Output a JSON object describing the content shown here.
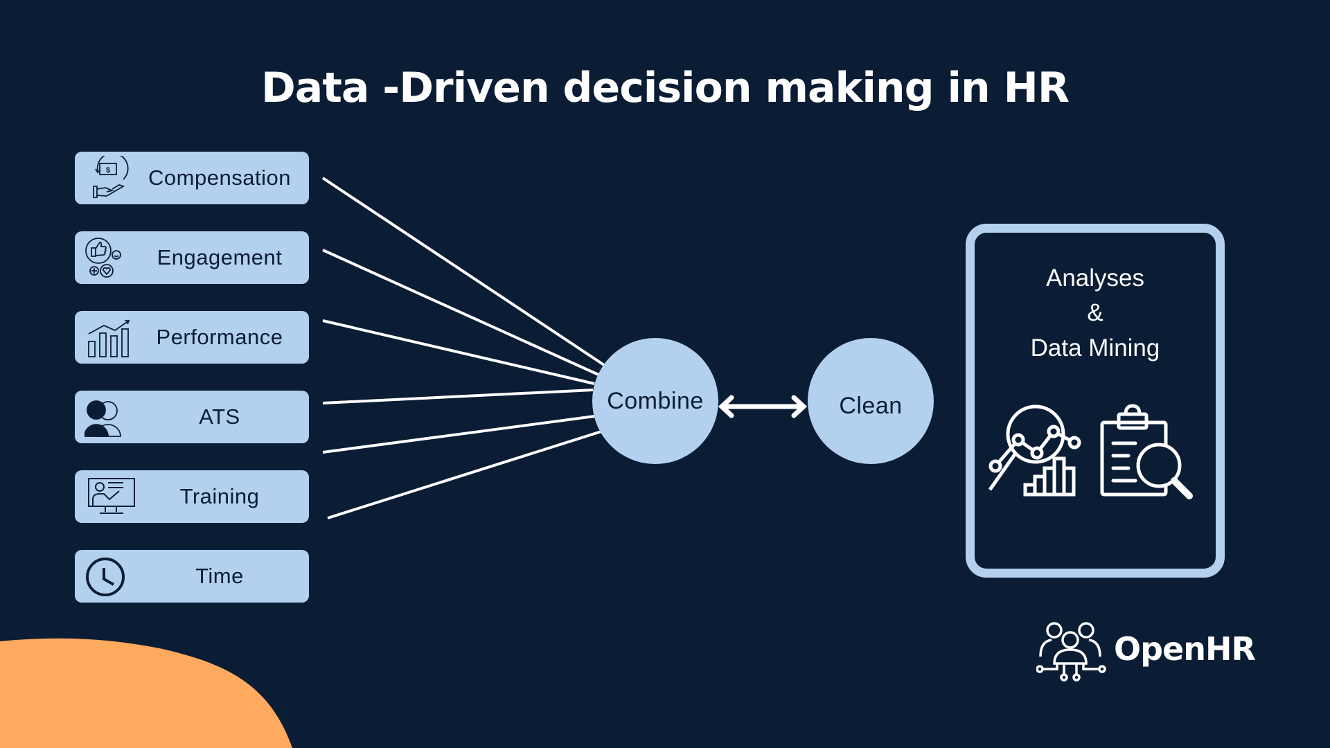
{
  "title": "Data -Driven decision making in HR",
  "sources": [
    {
      "label": "Compensation",
      "icon": "compensation-icon"
    },
    {
      "label": "Engagement",
      "icon": "engagement-icon"
    },
    {
      "label": "Performance",
      "icon": "performance-icon"
    },
    {
      "label": "ATS",
      "icon": "people-icon"
    },
    {
      "label": "Training",
      "icon": "training-icon"
    },
    {
      "label": "Time",
      "icon": "clock-icon"
    }
  ],
  "nodes": {
    "combine": "Combine",
    "clean": "Clean"
  },
  "panel": {
    "line1": "Analyses",
    "line2": "&",
    "line3": "Data Mining"
  },
  "brand": {
    "name": "OpenHR"
  },
  "colors": {
    "background": "#0b1d35",
    "box": "#b3d0ee",
    "text_dark": "#0b1d35",
    "accent_orange": "#ffaa5e",
    "line": "#ffffff"
  }
}
